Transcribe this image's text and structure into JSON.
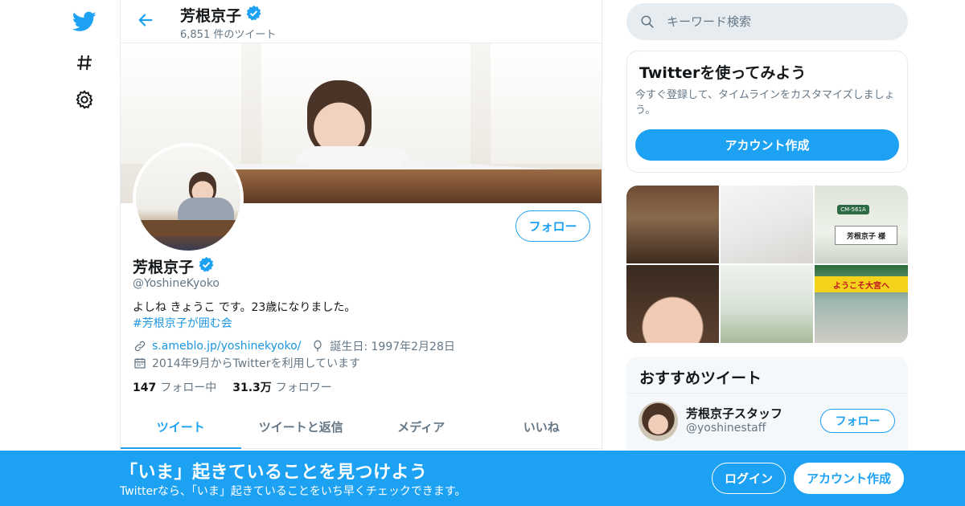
{
  "nav": {
    "icons": [
      "twitter-bird-icon",
      "hashtag-icon",
      "gear-icon"
    ]
  },
  "header": {
    "name": "芳根京子",
    "tweet_count": "6,851 件のツイート"
  },
  "profile": {
    "name": "芳根京子",
    "handle": "@YoshineKyoko",
    "bio": "よしね きょうこ です。23歳になりました。",
    "hashtag": "#芳根京子が囲む会",
    "link": "s.ameblo.jp/yoshinekyoko/",
    "birthday": "誕生日: 1997年2月28日",
    "joined": "2014年9月からTwitterを利用しています",
    "following_count": "147",
    "following_label": "フォロー中",
    "followers_count": "31.3万",
    "followers_label": "フォロワー",
    "follow_button": "フォロー"
  },
  "tabs": [
    {
      "label": "ツイート",
      "active": true
    },
    {
      "label": "ツイートと返信",
      "active": false
    },
    {
      "label": "メディア",
      "active": false
    },
    {
      "label": "いいね",
      "active": false
    }
  ],
  "search": {
    "placeholder": "キーワード検索"
  },
  "signup_card": {
    "title": "Twitterを使ってみよう",
    "text": "今すぐ登録して、タイムラインをカスタマイズしましょう。",
    "button": "アカウント作成"
  },
  "gallery": {
    "photo3_sign": "芳根京子 様",
    "photo3_pill": "CM-561A",
    "photo6_banner": "ようこそ大宮へ"
  },
  "recommended": {
    "title": "おすすめツイート",
    "account_name": "芳根京子スタッフ",
    "account_handle": "@yoshinestaff",
    "follow_button": "フォロー"
  },
  "bottom_bar": {
    "title": "「いま」起きていることを見つけよう",
    "subtitle": "Twitterなら、「いま」起きていることをいち早くチェックできます。",
    "login": "ログイン",
    "signup": "アカウント作成"
  },
  "colors": {
    "brand": "#1da1f2",
    "link": "#1b95e0",
    "muted": "#657786"
  }
}
